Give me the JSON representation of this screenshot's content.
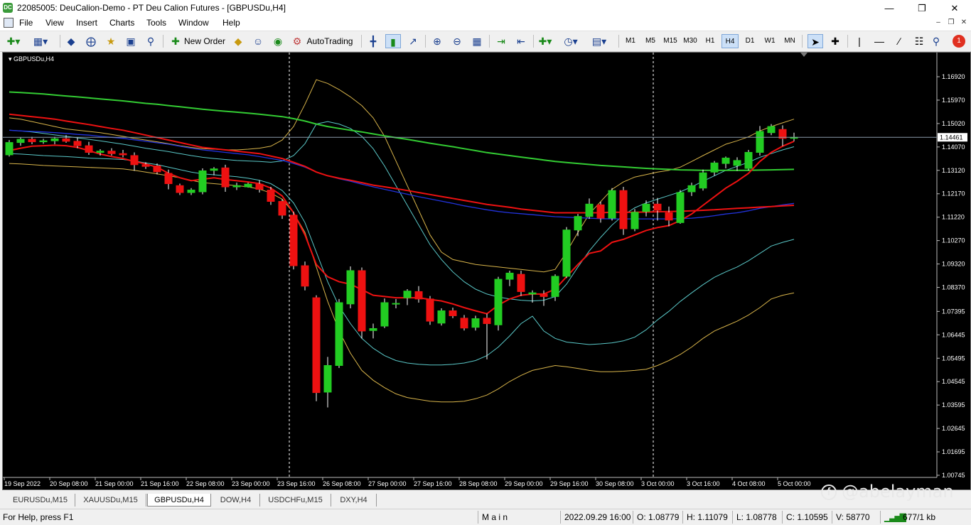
{
  "window": {
    "title": "22085005: DeuCalion-Demo - PT Deu Calion Futures - [GBPUSDu,H4]",
    "app_icon_text": "DC"
  },
  "menu": [
    "File",
    "View",
    "Insert",
    "Charts",
    "Tools",
    "Window",
    "Help"
  ],
  "toolbar": {
    "new_order": "New Order",
    "auto_trading": "AutoTrading",
    "timeframes": [
      "M1",
      "M5",
      "M15",
      "M30",
      "H1",
      "H4",
      "D1",
      "W1",
      "MN"
    ],
    "active_timeframe": "H4",
    "notification_count": "1"
  },
  "chart": {
    "symbol_label": "GBPUSDu,H4",
    "current_price": "1.14461",
    "background": "#000000",
    "bull_color": "#22cc22",
    "bear_color": "#ee1111",
    "price_levels": [
      "1.16920",
      "1.15970",
      "1.15020",
      "1.14070",
      "1.13120",
      "1.12170",
      "1.11220",
      "1.10270",
      "1.09320",
      "1.08370",
      "1.07395",
      "1.06445",
      "1.05495",
      "1.04545",
      "1.03595",
      "1.02645",
      "1.01695",
      "1.00745"
    ],
    "time_labels": [
      "19 Sep 2022",
      "20 Sep 08:00",
      "21 Sep 00:00",
      "21 Sep 16:00",
      "22 Sep 08:00",
      "23 Sep 00:00",
      "23 Sep 16:00",
      "26 Sep 08:00",
      "27 Sep 00:00",
      "27 Sep 16:00",
      "28 Sep 08:00",
      "29 Sep 00:00",
      "29 Sep 16:00",
      "30 Sep 08:00",
      "3 Oct 00:00",
      "3 Oct 16:00",
      "4 Oct 08:00",
      "5 Oct 00:00"
    ]
  },
  "chart_data": {
    "type": "candlestick",
    "symbol": "GBPUSDu",
    "timeframe": "H4",
    "ylim": [
      1.00745,
      1.1692
    ],
    "candles": [
      [
        1.1375,
        1.1435,
        1.1368,
        1.1425
      ],
      [
        1.1425,
        1.1445,
        1.1412,
        1.1438
      ],
      [
        1.1438,
        1.1448,
        1.1418,
        1.1428
      ],
      [
        1.1428,
        1.144,
        1.142,
        1.1432
      ],
      [
        1.1432,
        1.1448,
        1.1418,
        1.144
      ],
      [
        1.144,
        1.1455,
        1.1424,
        1.143
      ],
      [
        1.143,
        1.1445,
        1.1402,
        1.1412
      ],
      [
        1.1412,
        1.1428,
        1.1375,
        1.1385
      ],
      [
        1.1385,
        1.1398,
        1.1372,
        1.139
      ],
      [
        1.139,
        1.1402,
        1.1372,
        1.138
      ],
      [
        1.138,
        1.1395,
        1.1365,
        1.1375
      ],
      [
        1.1372,
        1.1385,
        1.131,
        1.1335
      ],
      [
        1.1335,
        1.1345,
        1.1318,
        1.1328
      ],
      [
        1.133,
        1.134,
        1.1296,
        1.1306
      ],
      [
        1.13,
        1.1315,
        1.1235,
        1.1258
      ],
      [
        1.125,
        1.1258,
        1.1212,
        1.1222
      ],
      [
        1.1222,
        1.124,
        1.1212,
        1.1232
      ],
      [
        1.1225,
        1.132,
        1.1215,
        1.131
      ],
      [
        1.1312,
        1.1325,
        1.1292,
        1.1318
      ],
      [
        1.1322,
        1.1335,
        1.1225,
        1.1245
      ],
      [
        1.1245,
        1.1262,
        1.1232,
        1.125
      ],
      [
        1.1245,
        1.1262,
        1.1242,
        1.1256
      ],
      [
        1.1256,
        1.1272,
        1.1222,
        1.1235
      ],
      [
        1.1232,
        1.1245,
        1.1172,
        1.1186
      ],
      [
        1.1186,
        1.1195,
        1.1115,
        1.113
      ],
      [
        1.113,
        1.1145,
        1.091,
        1.0925
      ],
      [
        1.0925,
        1.0942,
        1.0825,
        1.0842
      ],
      [
        1.0795,
        1.0805,
        1.0375,
        1.041
      ],
      [
        1.0412,
        1.0555,
        1.035,
        1.052
      ],
      [
        1.052,
        1.079,
        1.051,
        1.0775
      ],
      [
        1.077,
        1.0922,
        1.0752,
        1.0905
      ],
      [
        1.0905,
        1.0918,
        1.063,
        1.066
      ],
      [
        1.0662,
        1.069,
        1.063,
        1.067
      ],
      [
        1.068,
        1.0792,
        1.0672,
        1.0775
      ],
      [
        1.077,
        1.079,
        1.0752,
        1.0772
      ],
      [
        1.0795,
        1.083,
        1.0765,
        1.0822
      ],
      [
        1.082,
        1.0842,
        1.0775,
        1.079
      ],
      [
        1.079,
        1.0802,
        1.0685,
        1.07
      ],
      [
        1.0692,
        1.0752,
        1.0682,
        1.0742
      ],
      [
        1.0742,
        1.0755,
        1.0712,
        1.0722
      ],
      [
        1.0712,
        1.0725,
        1.0662,
        1.0672
      ],
      [
        1.0675,
        1.0722,
        1.0662,
        1.071
      ],
      [
        1.0712,
        1.073,
        1.0545,
        1.069
      ],
      [
        1.0685,
        1.088,
        1.0662,
        1.087
      ],
      [
        1.087,
        1.0905,
        1.0842,
        1.0895
      ],
      [
        1.089,
        1.0905,
        1.0802,
        1.082
      ],
      [
        1.081,
        1.0825,
        1.0775,
        1.0815
      ],
      [
        1.081,
        1.0825,
        1.0762,
        1.08
      ],
      [
        1.08,
        1.089,
        1.0782,
        1.0882
      ],
      [
        1.0882,
        1.1082,
        1.0875,
        1.107
      ],
      [
        1.107,
        1.1135,
        1.1045,
        1.1125
      ],
      [
        1.1125,
        1.1198,
        1.1115,
        1.1175
      ],
      [
        1.1172,
        1.1185,
        1.11,
        1.1118
      ],
      [
        1.1118,
        1.124,
        1.1108,
        1.123
      ],
      [
        1.123,
        1.1245,
        1.105,
        1.1075
      ],
      [
        1.1075,
        1.1155,
        1.1065,
        1.1142
      ],
      [
        1.1145,
        1.119,
        1.1125,
        1.1175
      ],
      [
        1.1175,
        1.12,
        1.1108,
        1.115
      ],
      [
        1.114,
        1.1165,
        1.1085,
        1.111
      ],
      [
        1.11,
        1.1232,
        1.1095,
        1.1222
      ],
      [
        1.1225,
        1.1262,
        1.1208,
        1.125
      ],
      [
        1.124,
        1.1315,
        1.123,
        1.1302
      ],
      [
        1.1305,
        1.135,
        1.129,
        1.1342
      ],
      [
        1.134,
        1.1368,
        1.132,
        1.1362
      ],
      [
        1.1332,
        1.1365,
        1.131,
        1.1352
      ],
      [
        1.132,
        1.1395,
        1.1312,
        1.1385
      ],
      [
        1.1385,
        1.1492,
        1.1372,
        1.147
      ],
      [
        1.1465,
        1.15,
        1.1455,
        1.149
      ],
      [
        1.1478,
        1.1495,
        1.141,
        1.1442
      ],
      [
        1.1442,
        1.1465,
        1.143,
        1.1446
      ]
    ],
    "indicators": {
      "ema_red_fast": [
        1.1392,
        1.1402,
        1.141,
        1.1412,
        1.1414,
        1.1412,
        1.1405,
        1.1392,
        1.1378,
        1.1368,
        1.136,
        1.1348,
        1.1338,
        1.1325,
        1.13,
        1.1282,
        1.127,
        1.1276,
        1.1282,
        1.1275,
        1.127,
        1.1265,
        1.1258,
        1.124,
        1.1208,
        1.114,
        1.105,
        1.093,
        1.088,
        1.086,
        1.085,
        1.0828,
        1.0805,
        1.08,
        1.0795,
        1.0795,
        1.0795,
        1.0788,
        1.0782,
        1.077,
        1.0755,
        1.0742,
        1.073,
        1.0765,
        1.079,
        1.0805,
        1.081,
        1.081,
        1.083,
        1.088,
        1.093,
        1.0975,
        1.0985,
        1.102,
        1.1032,
        1.105,
        1.1068,
        1.108,
        1.1088,
        1.1108,
        1.1135,
        1.117,
        1.1205,
        1.124,
        1.1268,
        1.13,
        1.1348,
        1.1385,
        1.141,
        1.143
      ],
      "ema_red_slow": [
        1.154,
        1.1535,
        1.153,
        1.1525,
        1.152,
        1.1512,
        1.1505,
        1.1498,
        1.149,
        1.1482,
        1.1475,
        1.1465,
        1.1455,
        1.1445,
        1.1435,
        1.1425,
        1.1415,
        1.1405,
        1.14,
        1.1395,
        1.139,
        1.1385,
        1.138,
        1.137,
        1.136,
        1.1345,
        1.1328,
        1.1305,
        1.129,
        1.128,
        1.1272,
        1.1262,
        1.1252,
        1.1245,
        1.1238,
        1.123,
        1.1222,
        1.1214,
        1.1206,
        1.1198,
        1.119,
        1.1182,
        1.1174,
        1.1168,
        1.1162,
        1.1155,
        1.115,
        1.1145,
        1.114,
        1.114,
        1.114,
        1.114,
        1.114,
        1.1142,
        1.1142,
        1.1142,
        1.1143,
        1.1144,
        1.1145,
        1.1146,
        1.1148,
        1.115,
        1.1152,
        1.1155,
        1.1158,
        1.116,
        1.1163,
        1.1165,
        1.1168,
        1.117
      ],
      "ema_blue": [
        1.1475,
        1.1472,
        1.147,
        1.1468,
        1.1465,
        1.1462,
        1.1458,
        1.1455,
        1.145,
        1.1446,
        1.1442,
        1.1436,
        1.143,
        1.1424,
        1.1418,
        1.141,
        1.1402,
        1.1395,
        1.139,
        1.1385,
        1.138,
        1.1375,
        1.1368,
        1.136,
        1.1352,
        1.134,
        1.1325,
        1.1305,
        1.129,
        1.1278,
        1.1268,
        1.1256,
        1.1245,
        1.1235,
        1.1225,
        1.1215,
        1.1205,
        1.1196,
        1.1187,
        1.1178,
        1.1168,
        1.116,
        1.1152,
        1.1145,
        1.114,
        1.1136,
        1.1132,
        1.1128,
        1.1124,
        1.1122,
        1.112,
        1.1118,
        1.1116,
        1.1115,
        1.1115,
        1.1115,
        1.1115,
        1.1115,
        1.1115,
        1.1116,
        1.1118,
        1.1122,
        1.1128,
        1.1135,
        1.114,
        1.1148,
        1.1158,
        1.1165,
        1.1172,
        1.1178
      ],
      "ema_green": [
        1.163,
        1.1628,
        1.1625,
        1.1622,
        1.1618,
        1.1614,
        1.161,
        1.1606,
        1.1602,
        1.1598,
        1.1594,
        1.1589,
        1.1584,
        1.158,
        1.1575,
        1.157,
        1.1565,
        1.156,
        1.1556,
        1.1552,
        1.1548,
        1.1544,
        1.154,
        1.1535,
        1.153,
        1.1522,
        1.1512,
        1.15,
        1.149,
        1.1482,
        1.1475,
        1.1468,
        1.146,
        1.1452,
        1.1445,
        1.1438,
        1.143,
        1.1422,
        1.1415,
        1.1408,
        1.14,
        1.1392,
        1.1384,
        1.1378,
        1.1372,
        1.1366,
        1.136,
        1.1354,
        1.1348,
        1.1344,
        1.134,
        1.1336,
        1.1332,
        1.1329,
        1.1326,
        1.1323,
        1.132,
        1.1318,
        1.1316,
        1.1314,
        1.1313,
        1.1312,
        1.1312,
        1.1312,
        1.1312,
        1.1312,
        1.1313,
        1.1314,
        1.1315,
        1.1316
      ],
      "bb_yellow_upper": [
        1.1525,
        1.152,
        1.151,
        1.15,
        1.149,
        1.148,
        1.1475,
        1.147,
        1.1465,
        1.1458,
        1.145,
        1.1442,
        1.1435,
        1.1428,
        1.142,
        1.1412,
        1.1405,
        1.14,
        1.1398,
        1.1396,
        1.1395,
        1.1398,
        1.1402,
        1.141,
        1.1435,
        1.149,
        1.158,
        1.168,
        1.1665,
        1.164,
        1.161,
        1.1575,
        1.1525,
        1.145,
        1.135,
        1.125,
        1.115,
        1.105,
        1.098,
        1.095,
        1.094,
        1.093,
        1.0925,
        1.092,
        1.0915,
        1.091,
        1.0905,
        1.09,
        1.091,
        1.098,
        1.106,
        1.1135,
        1.1185,
        1.1235,
        1.1265,
        1.1285,
        1.1295,
        1.1305,
        1.1312,
        1.1325,
        1.1348,
        1.1372,
        1.1395,
        1.1418,
        1.1432,
        1.1448,
        1.1472,
        1.149,
        1.1505,
        1.152
      ],
      "bb_yellow_lower": [
        1.134,
        1.1338,
        1.1335,
        1.1332,
        1.133,
        1.1328,
        1.1326,
        1.1324,
        1.1322,
        1.132,
        1.1318,
        1.1312,
        1.1305,
        1.1298,
        1.129,
        1.1282,
        1.1272,
        1.1262,
        1.1258,
        1.1254,
        1.125,
        1.1245,
        1.1236,
        1.122,
        1.1195,
        1.114,
        1.106,
        1.092,
        1.078,
        1.066,
        1.057,
        1.05,
        1.046,
        1.043,
        1.0405,
        1.039,
        1.0382,
        1.0375,
        1.0372,
        1.0372,
        1.0375,
        1.0385,
        1.04,
        1.0425,
        1.0455,
        1.048,
        1.05,
        1.051,
        1.052,
        1.0515,
        1.0508,
        1.05,
        1.0495,
        1.0495,
        1.0497,
        1.05,
        1.0505,
        1.052,
        1.054,
        1.0565,
        1.0595,
        1.063,
        1.066,
        1.068,
        1.07,
        1.0725,
        1.0755,
        1.079,
        1.0805,
        1.0815
      ],
      "bb_cyan_upper": [
        1.1475,
        1.1472,
        1.1468,
        1.1462,
        1.1456,
        1.145,
        1.1444,
        1.1438,
        1.1432,
        1.1425,
        1.1418,
        1.141,
        1.1402,
        1.1395,
        1.1388,
        1.138,
        1.1372,
        1.1365,
        1.136,
        1.1356,
        1.1352,
        1.135,
        1.1348,
        1.1345,
        1.135,
        1.1372,
        1.142,
        1.15,
        1.151,
        1.15,
        1.1482,
        1.145,
        1.14,
        1.133,
        1.125,
        1.117,
        1.109,
        1.101,
        1.095,
        1.09,
        1.086,
        1.083,
        1.081,
        1.0798,
        1.079,
        1.0785,
        1.0782,
        1.0785,
        1.08,
        1.085,
        1.092,
        1.0985,
        1.104,
        1.109,
        1.113,
        1.116,
        1.118,
        1.1195,
        1.121,
        1.1225,
        1.1245,
        1.1268,
        1.129,
        1.1312,
        1.1328,
        1.1345,
        1.1365,
        1.138,
        1.1395,
        1.1408
      ],
      "bb_cyan_lower": [
        1.138,
        1.1378,
        1.1375,
        1.1372,
        1.137,
        1.1368,
        1.1365,
        1.1362,
        1.136,
        1.1358,
        1.1356,
        1.135,
        1.1342,
        1.1335,
        1.1325,
        1.1315,
        1.1305,
        1.1298,
        1.1294,
        1.129,
        1.1286,
        1.128,
        1.1272,
        1.1258,
        1.123,
        1.118,
        1.11,
        1.098,
        1.086,
        1.076,
        1.069,
        1.063,
        1.059,
        1.056,
        1.054,
        1.053,
        1.0525,
        1.0522,
        1.0522,
        1.0525,
        1.053,
        1.054,
        1.056,
        1.0595,
        1.064,
        1.069,
        1.072,
        1.066,
        1.063,
        1.0615,
        1.061,
        1.0605,
        1.0608,
        1.0612,
        1.062,
        1.0635,
        1.0665,
        1.0705,
        1.074,
        1.078,
        1.0815,
        1.0848,
        1.0878,
        1.09,
        1.092,
        1.0945,
        1.0975,
        1.1005,
        1.102,
        1.1032
      ]
    },
    "vertical_markers": [
      "23 Sep 16:00",
      "3 Oct 00:00"
    ]
  },
  "tabs": [
    "EURUSDu,M15",
    "XAUUSDu,M15",
    "GBPUSDu,H4",
    "DOW,H4",
    "USDCHFu,M15",
    "DXY,H4"
  ],
  "active_tab": "GBPUSDu,H4",
  "watermark": "@abelayman",
  "status": {
    "help": "For Help, press F1",
    "profile": "M a i n",
    "datetime": "2022.09.29 16:00",
    "open": "O: 1.08779",
    "high": "H: 1.11079",
    "low": "L: 1.08778",
    "close": "C: 1.10595",
    "volume": "V: 58770",
    "traffic": "677/1 kb"
  }
}
